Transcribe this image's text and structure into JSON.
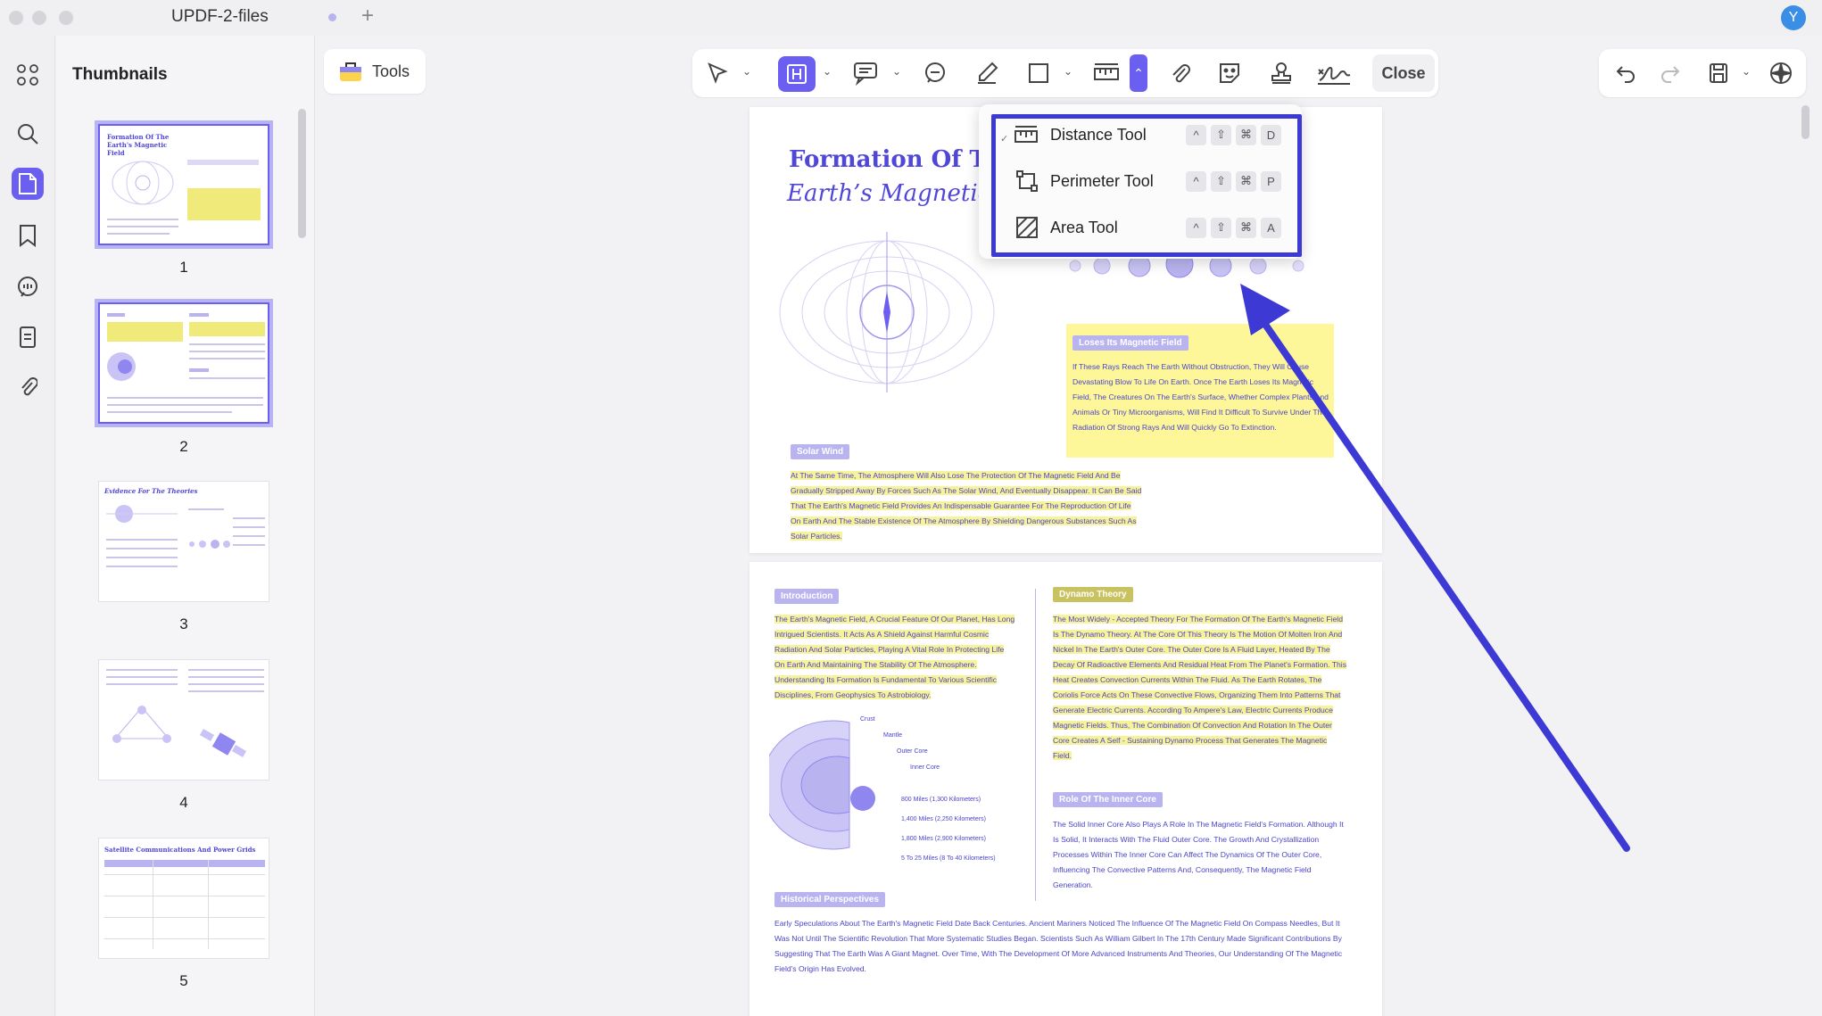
{
  "window": {
    "title": "UPDF-2-files",
    "avatar_initial": "Y"
  },
  "sidebar": {
    "title": "Thumbnails",
    "pages": [
      "1",
      "2",
      "3",
      "4",
      "5"
    ]
  },
  "toolbar": {
    "tools_label": "Tools",
    "close_label": "Close"
  },
  "measure_menu": {
    "items": [
      {
        "label": "Distance Tool",
        "keys": [
          "^",
          "⇧",
          "⌘",
          "D"
        ]
      },
      {
        "label": "Perimeter Tool",
        "keys": [
          "^",
          "⇧",
          "⌘",
          "P"
        ]
      },
      {
        "label": "Area Tool",
        "keys": [
          "^",
          "⇧",
          "⌘",
          "A"
        ]
      }
    ]
  },
  "page1": {
    "title": "Formation Of The",
    "subtitle": "Earth’s Magnetic Fie",
    "tag_loses": "Loses Its Magnetic Field",
    "loses_text": "If These Rays Reach The Earth Without Obstruction, They Will Cause Devastating Blow To Life On Earth. Once The Earth Loses Its Magnetic Field, The Creatures On The Earth's Surface, Whether Complex Plants And Animals Or Tiny Microorganisms, Will Find It Difficult To Survive Under The Radiation Of Strong Rays And Will Quickly Go To Extinction.",
    "tag_solar": "Solar Wind",
    "solar_text": "At The Same Time, The Atmosphere Will Also Lose The Protection Of The Magnetic Field And Be Gradually Stripped Away By Forces Such As The Solar Wind, And Eventually Disappear. It Can Be Said That The Earth's Magnetic Field Provides An Indispensable Guarantee For The Reproduction Of Life On Earth And The Stable Existence Of The Atmosphere By Shielding Dangerous Substances Such As Solar Particles."
  },
  "page2": {
    "tag_intro": "Introduction",
    "intro_text": "The Earth's Magnetic Field, A Crucial Feature Of Our Planet, Has Long Intrigued Scientists. It Acts As A Shield Against Harmful Cosmic Radiation And Solar Particles, Playing A Vital Role In Protecting Life On Earth And Maintaining The Stability Of The Atmosphere. Understanding Its Formation Is Fundamental To Various Scientific Disciplines, From Geophysics To Astrobiology.",
    "tag_dynamo": "Dynamo Theory",
    "dynamo_text": "The Most Widely - Accepted Theory For The Formation Of The Earth's Magnetic Field Is The Dynamo Theory. At The Core Of This Theory Is The Motion Of Molten Iron And Nickel In The Earth's Outer Core. The Outer Core Is A Fluid Layer, Heated By The Decay Of Radioactive Elements And Residual Heat From The Planet's Formation. This Heat Creates Convection Currents Within The Fluid. As The Earth Rotates, The Coriolis Force Acts On These Convective Flows, Organizing Them Into Patterns That Generate Electric Currents. According To Ampere's Law, Electric Currents Produce Magnetic Fields. Thus, The Combination Of Convection And Rotation In The Outer Core Creates A Self - Sustaining Dynamo Process That Generates The Magnetic Field.",
    "tag_inner": "Role Of The Inner Core",
    "inner_text": "The Solid Inner Core Also Plays A Role In The Magnetic Field's Formation. Although It Is Solid, It Interacts With The Fluid Outer Core. The Growth And Crystallization Processes Within The Inner Core Can Affect The Dynamics Of The Outer Core, Influencing The Convective Patterns And, Consequently, The Magnetic Field Generation.",
    "tag_hist": "Historical Perspectives",
    "hist_text": "Early Speculations About The Earth's Magnetic Field Date Back Centuries. Ancient Mariners Noticed The Influence Of The Magnetic Field On Compass Needles, But It Was Not Until The Scientific Revolution That More Systematic Studies Began. Scientists Such As William Gilbert In The 17th Century Made Significant Contributions By Suggesting That The Earth Was A Giant Magnet. Over Time, With The Development Of More Advanced Instruments And Theories, Our Understanding Of The Magnetic Field's Origin Has Evolved.",
    "core_labels": [
      "Crust",
      "Mantle",
      "Outer Core",
      "Inner Core"
    ],
    "depth_labels": [
      "800 Miles (1,300 Kilometers)",
      "1,400 Miles (2,250 Kilometers)",
      "1,800 Miles (2,900 Kilometers)",
      "5 To 25 Miles (8 To 40 Kilometers)"
    ]
  },
  "thumb_texts": {
    "t1": "Formation Of The Earth's Magnetic Field",
    "t3": "Evidence For The Theories",
    "t5": "Satellite Communications And Power Grids"
  },
  "colors": {
    "accent": "#6b5ff2",
    "highlight_border": "#3d39d4",
    "arrow": "#3d39d4",
    "doc_text": "#4b44c8",
    "highlight": "#fdf79a"
  }
}
